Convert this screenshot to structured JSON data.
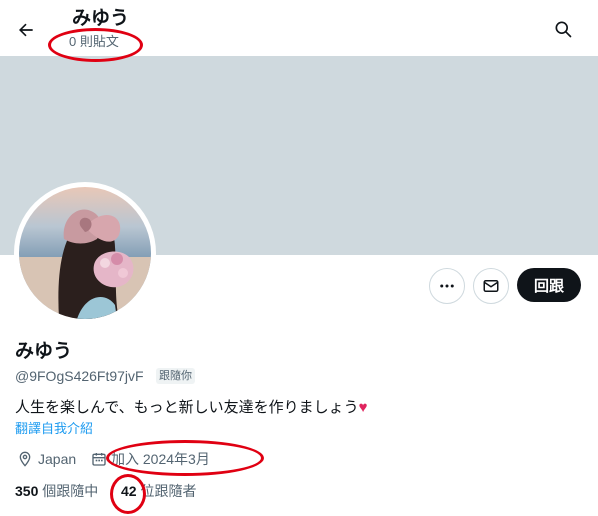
{
  "header": {
    "name": "みゆう",
    "post_count": "0 則貼文"
  },
  "profile": {
    "name": "みゆう",
    "handle": "@9FOgS426Ft97jvF",
    "follows_you": "跟隨你",
    "bio": "人生を楽しんで、もっと新しい友達を作りましょう",
    "bio_emoji": "♥",
    "translate_label": "翻譯自我介紹",
    "location": "Japan",
    "joined": "加入 2024年3月"
  },
  "actions": {
    "follow_back_label": "回跟"
  },
  "stats": {
    "following_count": "350",
    "following_label": "個跟隨中",
    "followers_count": "42",
    "followers_label": "位跟隨者"
  },
  "icons": [
    "back-arrow-icon",
    "search-icon",
    "more-icon",
    "mail-icon",
    "location-icon",
    "calendar-icon"
  ],
  "colors": {
    "banner": "#cfd9de",
    "accent": "#1d9bf0",
    "annotation": "#e00012",
    "primary_button": "#0f1419",
    "secondary_text": "#536471"
  }
}
